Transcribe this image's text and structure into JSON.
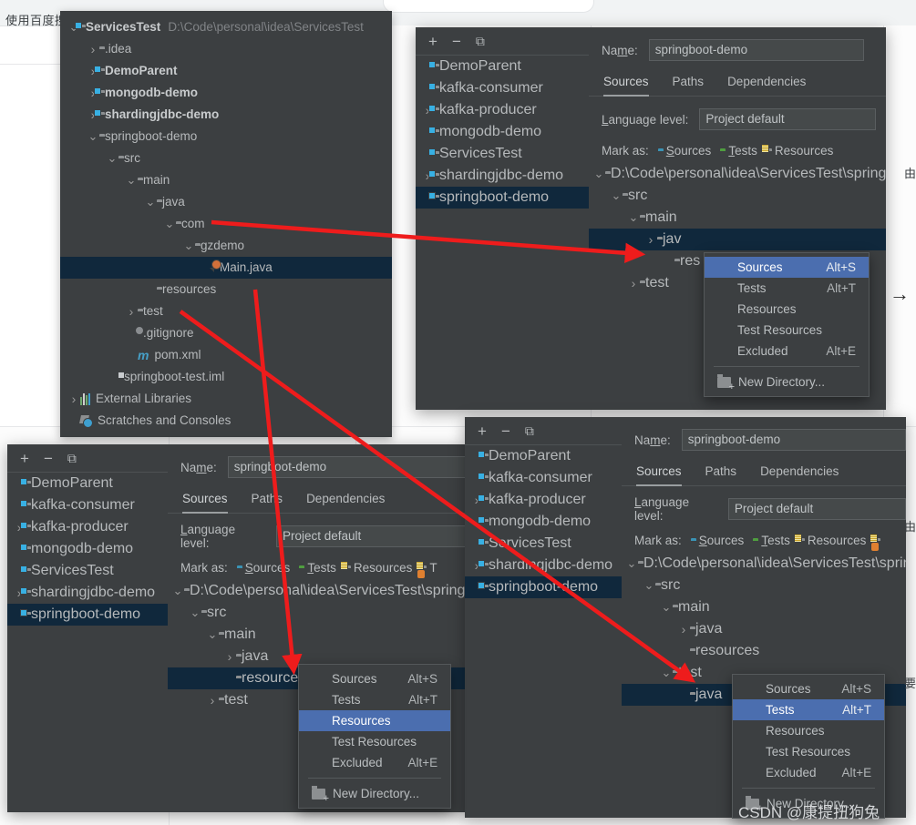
{
  "background": {
    "browser_hint_text": "使用百度搜",
    "right_arrow_glyph": "→",
    "right_edge_labels": [
      "由",
      "要"
    ]
  },
  "watermark": "CSDN @康提扭狗兔",
  "project_tree": {
    "title": "project-view",
    "items": [
      {
        "chev": "v",
        "icon": "module-folder-icon",
        "label": "ServicesTest",
        "bold": true,
        "suffix": "D:\\Code\\personal\\idea\\ServicesTest",
        "indent": 0,
        "selected": false
      },
      {
        "chev": ">",
        "icon": "folder-icon",
        "label": ".idea",
        "bold": false,
        "suffix": "",
        "indent": 1,
        "selected": false
      },
      {
        "chev": ">",
        "icon": "module-folder-icon",
        "label": "DemoParent",
        "bold": true,
        "suffix": "",
        "indent": 1,
        "selected": false
      },
      {
        "chev": ">",
        "icon": "module-folder-icon",
        "label": "mongodb-demo",
        "bold": true,
        "suffix": "",
        "indent": 1,
        "selected": false
      },
      {
        "chev": ">",
        "icon": "module-folder-icon",
        "label": "shardingjdbc-demo",
        "bold": true,
        "suffix": "",
        "indent": 1,
        "selected": false
      },
      {
        "chev": "v",
        "icon": "folder-icon",
        "label": "springboot-demo",
        "bold": false,
        "suffix": "",
        "indent": 1,
        "selected": false
      },
      {
        "chev": "v",
        "icon": "folder-icon",
        "label": "src",
        "bold": false,
        "suffix": "",
        "indent": 2,
        "selected": false
      },
      {
        "chev": "v",
        "icon": "folder-icon",
        "label": "main",
        "bold": false,
        "suffix": "",
        "indent": 3,
        "selected": false
      },
      {
        "chev": "v",
        "icon": "folder-icon",
        "label": "java",
        "bold": false,
        "suffix": "",
        "indent": 4,
        "selected": false
      },
      {
        "chev": "v",
        "icon": "folder-icon",
        "label": "com",
        "bold": false,
        "suffix": "",
        "indent": 5,
        "selected": false
      },
      {
        "chev": "v",
        "icon": "folder-icon",
        "label": "gzdemo",
        "bold": false,
        "suffix": "",
        "indent": 6,
        "selected": false
      },
      {
        "chev": "",
        "icon": "java-file-icon",
        "label": "Main.java",
        "bold": false,
        "suffix": "",
        "indent": 7,
        "selected": true
      },
      {
        "chev": "",
        "icon": "folder-icon",
        "label": "resources",
        "bold": false,
        "suffix": "",
        "indent": 4,
        "selected": false
      },
      {
        "chev": ">",
        "icon": "folder-icon",
        "label": "test",
        "bold": false,
        "suffix": "",
        "indent": 3,
        "selected": false
      },
      {
        "chev": "",
        "icon": "gitignore-icon",
        "label": ".gitignore",
        "bold": false,
        "suffix": "",
        "indent": 3,
        "selected": false
      },
      {
        "chev": "",
        "icon": "maven-m-icon",
        "label": "pom.xml",
        "bold": false,
        "suffix": "",
        "indent": 3,
        "selected": false
      },
      {
        "chev": "",
        "icon": "iml-file-icon",
        "label": "springboot-test.iml",
        "bold": false,
        "suffix": "",
        "indent": 2,
        "selected": false
      },
      {
        "chev": ">",
        "icon": "external-libraries-icon",
        "label": "External Libraries",
        "bold": false,
        "suffix": "",
        "indent": 0,
        "selected": false
      },
      {
        "chev": "",
        "icon": "scratches-icon",
        "label": "Scratches and Consoles",
        "bold": false,
        "suffix": "",
        "indent": 0,
        "selected": false
      }
    ]
  },
  "module_dialog_common": {
    "toolbar": {
      "add": "+",
      "remove": "−",
      "copy": "⧉"
    },
    "modules": [
      {
        "chev": "",
        "label": "DemoParent",
        "selected": false
      },
      {
        "chev": "",
        "label": "kafka-consumer",
        "selected": false
      },
      {
        "chev": ">",
        "label": "kafka-producer",
        "selected": false
      },
      {
        "chev": "",
        "label": "mongodb-demo",
        "selected": false
      },
      {
        "chev": "",
        "label": "ServicesTest",
        "selected": false
      },
      {
        "chev": ">",
        "label": "shardingjdbc-demo",
        "selected": false
      },
      {
        "chev": "",
        "label": "springboot-demo",
        "selected": true
      }
    ],
    "name_label": "Name:",
    "name_value": "springboot-demo",
    "tabs": [
      {
        "label": "Sources",
        "active": true
      },
      {
        "label": "Paths",
        "active": false
      },
      {
        "label": "Dependencies",
        "active": false
      }
    ],
    "language_level_label": "Language level:",
    "language_level_value": "Project default",
    "mark_as_label": "Mark as:",
    "mark_as_items": [
      {
        "label": "Sources",
        "kind": "sources"
      },
      {
        "label": "Tests",
        "kind": "tests"
      },
      {
        "label": "Resources",
        "kind": "resources"
      },
      {
        "label": "T",
        "kind": "test-resources"
      }
    ],
    "context_menu": {
      "items": [
        {
          "label": "Sources",
          "shortcut": "Alt+S"
        },
        {
          "label": "Tests",
          "shortcut": "Alt+T"
        },
        {
          "label": "Resources",
          "shortcut": ""
        },
        {
          "label": "Test Resources",
          "shortcut": ""
        },
        {
          "label": "Excluded",
          "shortcut": "Alt+E"
        }
      ],
      "new_directory": "New Directory..."
    }
  },
  "dialog_top_right": {
    "root_path": "D:\\Code\\personal\\idea\\ServicesTest\\spring",
    "source_tree": [
      {
        "chev": "v",
        "label": "D:\\Code\\personal\\idea\\ServicesTest\\spring",
        "indent": 0,
        "selected": false
      },
      {
        "chev": "v",
        "label": "src",
        "indent": 1,
        "selected": false
      },
      {
        "chev": "v",
        "label": "main",
        "indent": 2,
        "selected": false
      },
      {
        "chev": ">",
        "label": "jav",
        "indent": 3,
        "selected": true
      },
      {
        "chev": "",
        "label": "res",
        "indent": 4,
        "selected": false
      },
      {
        "chev": ">",
        "label": "test",
        "indent": 2,
        "selected": false
      }
    ],
    "highlighted_menu_item": "Sources"
  },
  "dialog_bottom_left": {
    "root_path": "D:\\Code\\personal\\idea\\ServicesTest\\springboot-",
    "source_tree": [
      {
        "chev": "v",
        "label": "D:\\Code\\personal\\idea\\ServicesTest\\springboot-",
        "indent": 0,
        "selected": false
      },
      {
        "chev": "v",
        "label": "src",
        "indent": 1,
        "selected": false
      },
      {
        "chev": "v",
        "label": "main",
        "indent": 2,
        "selected": false
      },
      {
        "chev": ">",
        "label": "java",
        "indent": 3,
        "selected": false
      },
      {
        "chev": "",
        "label": "resource",
        "indent": 3,
        "selected": true
      },
      {
        "chev": ">",
        "label": "test",
        "indent": 2,
        "selected": false
      }
    ],
    "highlighted_menu_item": "Resources"
  },
  "dialog_bottom_right": {
    "root_path": "D:\\Code\\personal\\idea\\ServicesTest\\springboo",
    "source_tree": [
      {
        "chev": "v",
        "label": "D:\\Code\\personal\\idea\\ServicesTest\\springboo",
        "indent": 0,
        "selected": false
      },
      {
        "chev": "v",
        "label": "src",
        "indent": 1,
        "selected": false
      },
      {
        "chev": "v",
        "label": "main",
        "indent": 2,
        "selected": false
      },
      {
        "chev": ">",
        "label": "java",
        "indent": 3,
        "selected": false
      },
      {
        "chev": "",
        "label": "resources",
        "indent": 3,
        "selected": false
      },
      {
        "chev": "v",
        "label": "test",
        "indent": 2,
        "selected": false
      },
      {
        "chev": "",
        "label": "java",
        "indent": 3,
        "selected": true
      }
    ],
    "highlighted_menu_item": "Tests"
  },
  "colors": {
    "panel_bg": "#3c3f41",
    "selection_row": "#10283c",
    "menu_highlight": "#4b6eaf",
    "annotation_arrow": "#ee1c1c",
    "module_marker": "#38b0e3",
    "sources_folder": "#3a93b5",
    "tests_folder": "#4f9e3f"
  }
}
